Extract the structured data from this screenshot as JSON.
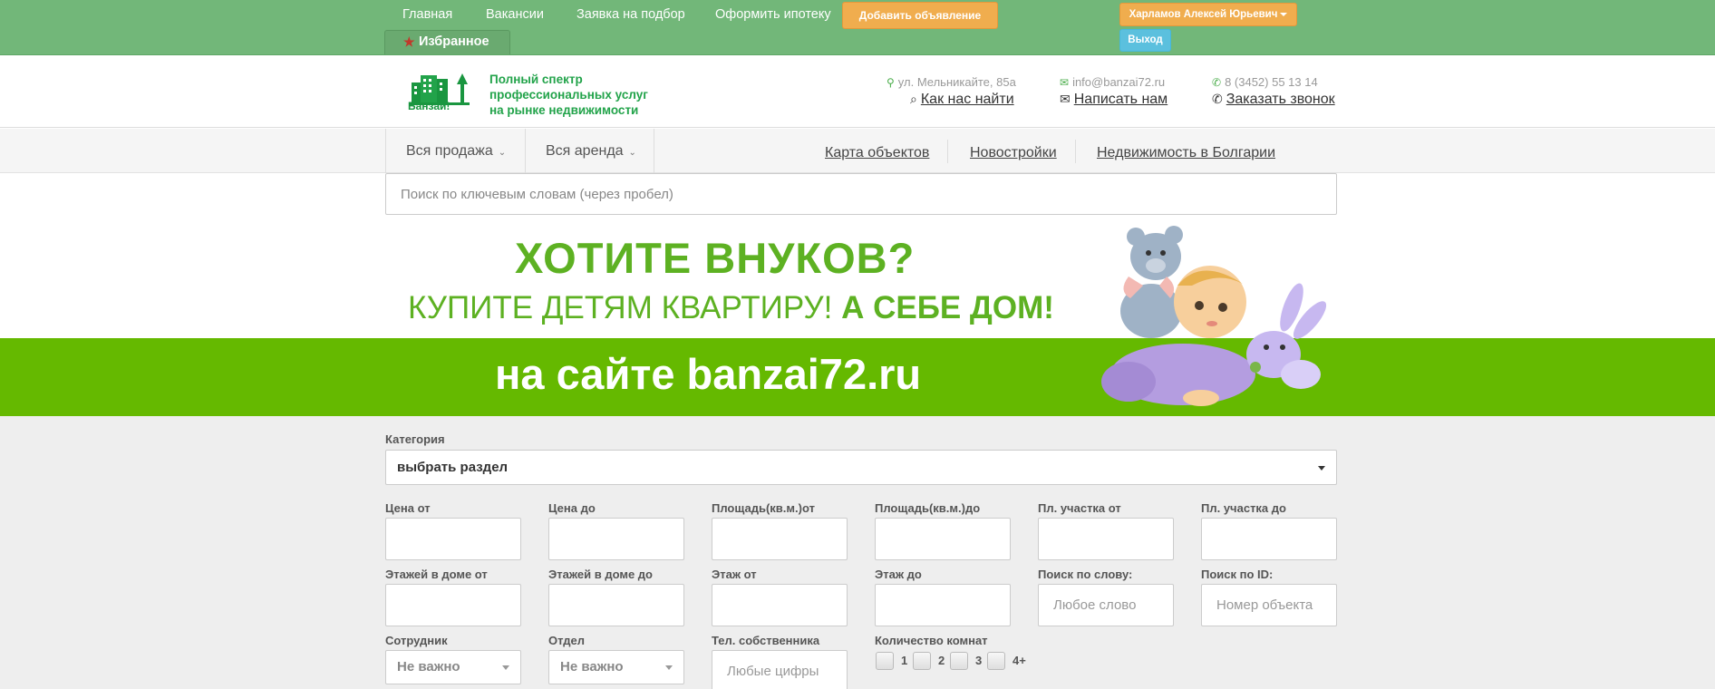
{
  "topnav": {
    "links": [
      "Главная",
      "Вакансии",
      "Заявка на подбор",
      "Оформить ипотеку"
    ],
    "add_ad": "Добавить объявление",
    "favorites": "Избранное",
    "user_name": "Харламов Алексей Юрьевич",
    "logout": "Выход",
    "colors": {
      "bar": "#72b779",
      "orange": "#f0ad4e",
      "blue": "#5bc0de"
    }
  },
  "header": {
    "logo_text": "Банзай!",
    "slogan": [
      "Полный спектр",
      "профессиональных услуг",
      "на рынке недвижимости"
    ],
    "address": "ул. Мельникайте, 85а",
    "find_us": "Как нас найти",
    "email": "info@banzai72.ru",
    "write_us": "Написать нам",
    "phone": "8 (3452) 55 13 14",
    "call_order": "Заказать звонок",
    "icons": [
      "map-marker-icon",
      "search-icon",
      "envelope-icon",
      "phone-icon"
    ]
  },
  "subnav": {
    "sale": "Вся продажа",
    "rent": "Вся аренда",
    "links": [
      "Карта объектов",
      "Новостройки",
      "Недвижимость в Болгарии"
    ]
  },
  "search": {
    "placeholder": "Поиск по ключевым словам (через пробел)"
  },
  "banner": {
    "line1": "ХОТИТЕ ВНУКОВ?",
    "line2_a": "КУПИТЕ ДЕТЯМ КВАРТИРУ! ",
    "line2_b": "А СЕБЕ ДОМ!",
    "line3": "на сайте banzai72.ru",
    "colors": {
      "green": "#65b900",
      "text": "#5db122"
    }
  },
  "filters": {
    "category_label": "Категория",
    "category_value": "выбрать раздел",
    "row1": [
      "Цена от",
      "Цена до",
      "Площадь(кв.м.)от",
      "Площадь(кв.м.)до",
      "Пл. участка от",
      "Пл. участка до"
    ],
    "row2": [
      "Этажей в доме от",
      "Этажей в доме до",
      "Этаж от",
      "Этаж до",
      "Поиск по слову:",
      "Поиск по ID:"
    ],
    "word_placeholder": "Любое слово",
    "id_placeholder": "Номер объекта",
    "employee_label": "Сотрудник",
    "employee_value": "Не важно",
    "dept_label": "Отдел",
    "dept_value": "Не важно",
    "owner_phone_label": "Тел. собственника",
    "owner_phone_placeholder": "Любые цифры",
    "rooms_label": "Количество комнат",
    "rooms": [
      "1",
      "2",
      "3",
      "4+"
    ]
  }
}
